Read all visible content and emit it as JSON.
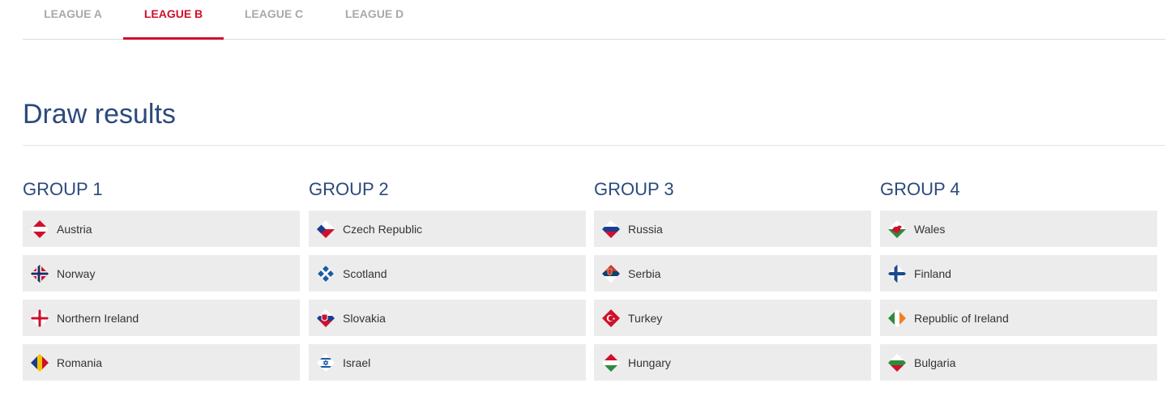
{
  "tabs": [
    {
      "label": "LEAGUE A",
      "active": false
    },
    {
      "label": "LEAGUE B",
      "active": true
    },
    {
      "label": "LEAGUE C",
      "active": false
    },
    {
      "label": "LEAGUE D",
      "active": false
    }
  ],
  "section": {
    "title": "Draw results"
  },
  "groups": [
    {
      "title": "GROUP 1",
      "teams": [
        {
          "name": "Austria",
          "flag": "austria-flag-icon"
        },
        {
          "name": "Norway",
          "flag": "norway-flag-icon"
        },
        {
          "name": "Northern Ireland",
          "flag": "northern-ireland-flag-icon"
        },
        {
          "name": "Romania",
          "flag": "romania-flag-icon"
        }
      ]
    },
    {
      "title": "GROUP 2",
      "teams": [
        {
          "name": "Czech Republic",
          "flag": "czech-republic-flag-icon"
        },
        {
          "name": "Scotland",
          "flag": "scotland-flag-icon"
        },
        {
          "name": "Slovakia",
          "flag": "slovakia-flag-icon"
        },
        {
          "name": "Israel",
          "flag": "israel-flag-icon"
        }
      ]
    },
    {
      "title": "GROUP 3",
      "teams": [
        {
          "name": "Russia",
          "flag": "russia-flag-icon"
        },
        {
          "name": "Serbia",
          "flag": "serbia-flag-icon"
        },
        {
          "name": "Turkey",
          "flag": "turkey-flag-icon"
        },
        {
          "name": "Hungary",
          "flag": "hungary-flag-icon"
        }
      ]
    },
    {
      "title": "GROUP 4",
      "teams": [
        {
          "name": "Wales",
          "flag": "wales-flag-icon"
        },
        {
          "name": "Finland",
          "flag": "finland-flag-icon"
        },
        {
          "name": "Republic of Ireland",
          "flag": "ireland-flag-icon"
        },
        {
          "name": "Bulgaria",
          "flag": "bulgaria-flag-icon"
        }
      ]
    }
  ],
  "colors": {
    "accent": "#d0102a",
    "heading": "#2c4a7c",
    "tab_inactive": "#a9a9a9",
    "card_bg": "#ececec"
  }
}
